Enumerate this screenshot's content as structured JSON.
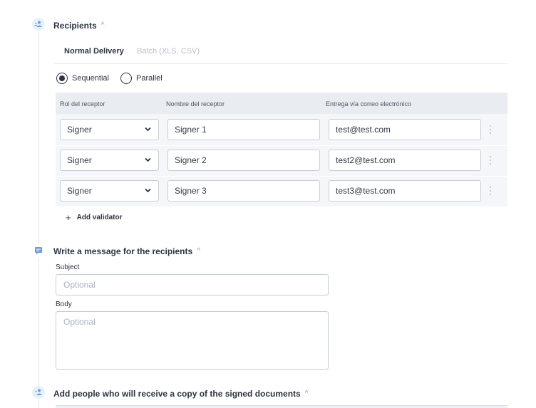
{
  "recipients_section": {
    "title": "Recipients",
    "icon": "people-icon",
    "tabs": [
      {
        "label": "Normal Delivery",
        "active": true
      },
      {
        "label": "Batch (XLS, CSV)",
        "active": false
      }
    ],
    "order_options": [
      {
        "label": "Sequential",
        "selected": true
      },
      {
        "label": "Parallel",
        "selected": false
      }
    ],
    "columns": [
      "Rol del receptor",
      "Nombre del receptor",
      "Entrega vía correo electrónico"
    ],
    "rows": [
      {
        "role": "Signer",
        "name": "Signer 1",
        "email": "test@test.com"
      },
      {
        "role": "Signer",
        "name": "Signer 2",
        "email": "test2@test.com"
      },
      {
        "role": "Signer",
        "name": "Signer 3",
        "email": "test3@test.com"
      }
    ],
    "add_validator_label": "Add validator"
  },
  "message_section": {
    "title": "Write a message for the recipients",
    "icon": "message-icon",
    "subject_label": "Subject",
    "subject_placeholder": "Optional",
    "body_label": "Body",
    "body_placeholder": "Optional"
  },
  "copy_section": {
    "title": "Add people who will receive a copy of the signed documents",
    "icon": "people-icon"
  },
  "colors": {
    "accent": "#2c3440",
    "icon_blue": "#6a9fd4",
    "table_bg": "#f4f6f9"
  }
}
